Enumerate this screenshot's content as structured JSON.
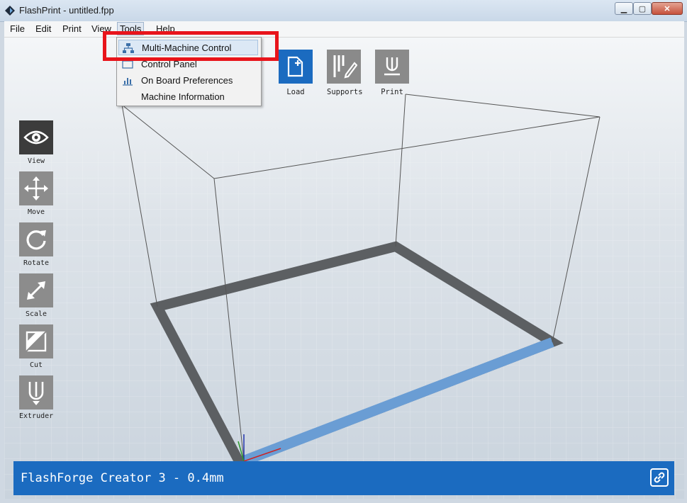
{
  "window": {
    "title": "FlashPrint - untitled.fpp"
  },
  "menubar": {
    "items": [
      "File",
      "Edit",
      "Print",
      "View",
      "Tools",
      "Help"
    ],
    "active": "Tools"
  },
  "tools_menu": {
    "items": [
      {
        "label": "Multi-Machine Control",
        "icon": "network-icon",
        "highlighted": true
      },
      {
        "label": "Control Panel",
        "icon": "control-panel-icon"
      },
      {
        "label": "On Board Preferences",
        "icon": "chart-icon"
      },
      {
        "label": "Machine Information",
        "icon": ""
      }
    ]
  },
  "top_toolbar": [
    {
      "label": "Load",
      "icon": "file-add-icon"
    },
    {
      "label": "Supports",
      "icon": "supports-icon"
    },
    {
      "label": "Print",
      "icon": "print-icon"
    }
  ],
  "left_toolbar": [
    {
      "label": "View",
      "icon": "eye-icon",
      "active": true
    },
    {
      "label": "Move",
      "icon": "move-icon"
    },
    {
      "label": "Rotate",
      "icon": "rotate-icon"
    },
    {
      "label": "Scale",
      "icon": "scale-icon"
    },
    {
      "label": "Cut",
      "icon": "cut-icon"
    },
    {
      "label": "Extruder",
      "icon": "extruder-icon"
    }
  ],
  "status": {
    "machine": "FlashForge Creator 3 - 0.4mm",
    "icon": "link-icon"
  },
  "colors": {
    "accent": "#1b6bc0",
    "highlight_box": "#e8141b",
    "tile": "#8c8c8c"
  }
}
